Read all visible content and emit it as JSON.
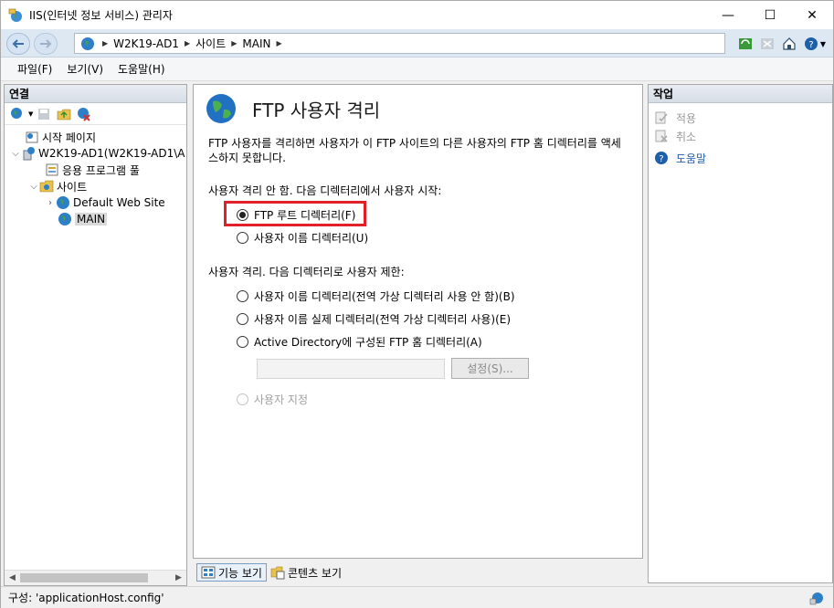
{
  "window": {
    "title": "IIS(인터넷 정보 서비스) 관리자",
    "minimize": "—",
    "maximize": "☐",
    "close": "✕"
  },
  "address": {
    "crumbs": [
      "W2K19-AD1",
      "사이트",
      "MAIN"
    ]
  },
  "menu": [
    "파일(F)",
    "보기(V)",
    "도움말(H)"
  ],
  "connections": {
    "header": "연결",
    "tree": [
      {
        "label": "시작 페이지"
      },
      {
        "label": "W2K19-AD1(W2K19-AD1\\A"
      },
      {
        "label": "응용 프로그램 풀"
      },
      {
        "label": "사이트"
      },
      {
        "label": "Default Web Site"
      },
      {
        "label": "MAIN"
      }
    ]
  },
  "feature": {
    "title": "FTP 사용자 격리",
    "description": "FTP 사용자를 격리하면 사용자가 이 FTP 사이트의 다른 사용자의 FTP 홈 디렉터리를 액세스하지 못합니다.",
    "no_isolation_label": "사용자 격리 안 함. 다음 디렉터리에서 사용자 시작:",
    "options_no_isolation": [
      {
        "label": "FTP 루트 디렉터리(F)",
        "checked": true
      },
      {
        "label": "사용자 이름 디렉터리(U)",
        "checked": false
      }
    ],
    "isolation_label": "사용자 격리. 다음 디렉터리로 사용자 제한:",
    "options_isolation": [
      {
        "label": "사용자 이름 디렉터리(전역 가상 디렉터리 사용 안 함)(B)",
        "checked": false
      },
      {
        "label": "사용자 이름 실제 디렉터리(전역 가상 디렉터리 사용)(E)",
        "checked": false
      },
      {
        "label": "Active Directory에 구성된 FTP 홈 디렉터리(A)",
        "checked": false
      }
    ],
    "ad_input_value": "",
    "ad_button": "설정(S)...",
    "custom_option": "사용자 지정"
  },
  "view_tabs": {
    "features": "기능 보기",
    "content": "콘텐츠 보기"
  },
  "actions": {
    "header": "작업",
    "apply": "적용",
    "cancel": "취소",
    "help": "도움말"
  },
  "status": {
    "text": "구성: 'applicationHost.config'"
  },
  "colors": {
    "highlight": "#e2202a",
    "help_link": "#1e5aa8"
  }
}
